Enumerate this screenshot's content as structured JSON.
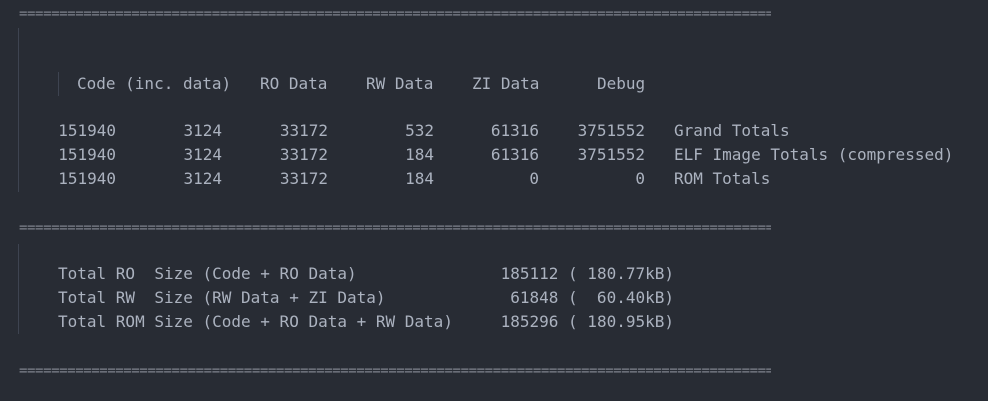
{
  "separator": "=================================================================================================",
  "header": {
    "code": "Code (inc. data)",
    "ro": "RO Data",
    "rw": "RW Data",
    "zi": "ZI Data",
    "debug": "Debug"
  },
  "rows": [
    {
      "code": "151940",
      "inc": "3124",
      "ro": "33172",
      "rw": "532",
      "zi": "61316",
      "debug": "3751552",
      "label": "Grand Totals"
    },
    {
      "code": "151940",
      "inc": "3124",
      "ro": "33172",
      "rw": "184",
      "zi": "61316",
      "debug": "3751552",
      "label": "ELF Image Totals (compressed)"
    },
    {
      "code": "151940",
      "inc": "3124",
      "ro": "33172",
      "rw": "184",
      "zi": "0",
      "debug": "0",
      "label": "ROM Totals"
    }
  ],
  "summary": [
    {
      "label": "Total RO  Size (Code + RO Data)",
      "value": "185112 ( 180.77kB)"
    },
    {
      "label": "Total RW  Size (RW Data + ZI Data)",
      "value": "61848 (  60.40kB)"
    },
    {
      "label": "Total ROM Size (Code + RO Data + RW Data)",
      "value": "185296 ( 180.95kB)"
    }
  ]
}
